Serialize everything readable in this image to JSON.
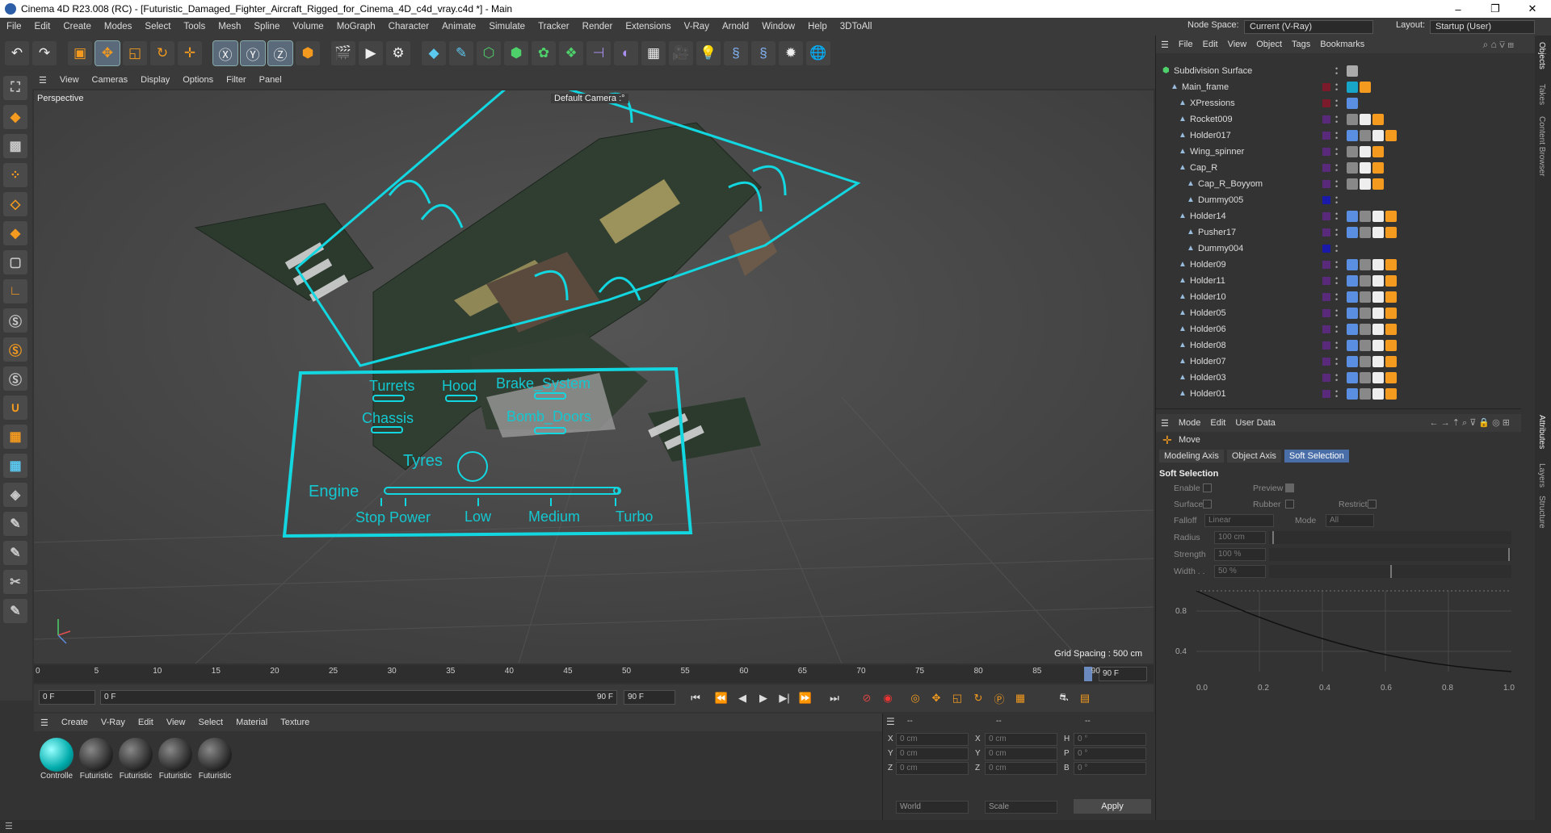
{
  "window": {
    "title": "Cinema 4D R23.008 (RC) - [Futuristic_Damaged_Fighter_Aircraft_Rigged_for_Cinema_4D_c4d_vray.c4d *] - Main",
    "controls": [
      "–",
      "❐",
      "✕"
    ]
  },
  "menubar": [
    "File",
    "Edit",
    "Create",
    "Modes",
    "Select",
    "Tools",
    "Mesh",
    "Spline",
    "Volume",
    "MoGraph",
    "Character",
    "Animate",
    "Simulate",
    "Tracker",
    "Render",
    "Extensions",
    "V-Ray",
    "Arnold",
    "Window",
    "Help",
    "3DToAll"
  ],
  "node_space": {
    "label": "Node Space:",
    "value": "Current (V-Ray)"
  },
  "layout": {
    "label": "Layout:",
    "value": "Startup (User)"
  },
  "viewport": {
    "menu": [
      "View",
      "Cameras",
      "Display",
      "Options",
      "Filter",
      "Panel"
    ],
    "name": "Perspective",
    "camera": "Default Camera :°",
    "grid_spacing": "Grid Spacing : 500 cm",
    "hud": {
      "turrets": "Turrets",
      "hood": "Hood",
      "brake": "Brake_System",
      "chassis": "Chassis",
      "bomb": "Bomb_Doors",
      "tyres": "Tyres",
      "engine": "Engine",
      "stop": "Stop",
      "power": "Power",
      "low": "Low",
      "medium": "Medium",
      "turbo": "Turbo"
    }
  },
  "timeline": {
    "ticks": [
      "0",
      "5",
      "10",
      "15",
      "20",
      "25",
      "30",
      "35",
      "40",
      "45",
      "50",
      "55",
      "60",
      "65",
      "70",
      "75",
      "80",
      "85",
      "90"
    ],
    "end_field": "90 F",
    "current": "0 F",
    "range_start": "0 F",
    "range_end": "90 F",
    "range_end2": "90 F"
  },
  "material_menu": [
    "Create",
    "V-Ray",
    "Edit",
    "View",
    "Select",
    "Material",
    "Texture"
  ],
  "materials": [
    {
      "name": "Controlle",
      "type": "cyan"
    },
    {
      "name": "Futuristic",
      "type": "dark"
    },
    {
      "name": "Futuristic",
      "type": "dark"
    },
    {
      "name": "Futuristic",
      "type": "dark"
    },
    {
      "name": "Futuristic",
      "type": "dark"
    }
  ],
  "coordinates": {
    "header": [
      "--",
      "--",
      "--"
    ],
    "rows": [
      {
        "a": "X",
        "av": "0 cm",
        "b": "X",
        "bv": "0 cm",
        "c": "H",
        "cv": "0 °"
      },
      {
        "a": "Y",
        "av": "0 cm",
        "b": "Y",
        "bv": "0 cm",
        "c": "P",
        "cv": "0 °"
      },
      {
        "a": "Z",
        "av": "0 cm",
        "b": "Z",
        "bv": "0 cm",
        "c": "B",
        "cv": "0 °"
      }
    ],
    "space": "World",
    "mode": "Scale",
    "apply": "Apply"
  },
  "objects_menu": [
    "File",
    "Edit",
    "View",
    "Object",
    "Tags",
    "Bookmarks"
  ],
  "objects": [
    {
      "name": "Subdivision Surface",
      "indent": 0,
      "color": "",
      "tags": "subd"
    },
    {
      "name": "Main_frame",
      "indent": 1,
      "color": "#7a1a2a",
      "tags": "main"
    },
    {
      "name": "XPressions",
      "indent": 2,
      "color": "#7a1a2a",
      "tags": "xp"
    },
    {
      "name": "Rocket009",
      "indent": 2,
      "color": "#5a2a7a",
      "tags": "std"
    },
    {
      "name": "Holder017",
      "indent": 2,
      "color": "#5a2a7a",
      "tags": "full"
    },
    {
      "name": "Wing_spinner",
      "indent": 2,
      "color": "#5a2a7a",
      "tags": "std2"
    },
    {
      "name": "Cap_R",
      "indent": 2,
      "color": "#5a2a7a",
      "tags": "std2"
    },
    {
      "name": "Cap_R_Boyyom",
      "indent": 3,
      "color": "#5a2a7a",
      "tags": "std2"
    },
    {
      "name": "Dummy005",
      "indent": 3,
      "color": "#1a1aaa",
      "tags": ""
    },
    {
      "name": "Holder14",
      "indent": 2,
      "color": "#5a2a7a",
      "tags": "full"
    },
    {
      "name": "Pusher17",
      "indent": 3,
      "color": "#5a2a7a",
      "tags": "full"
    },
    {
      "name": "Dummy004",
      "indent": 3,
      "color": "#1a1aaa",
      "tags": ""
    },
    {
      "name": "Holder09",
      "indent": 2,
      "color": "#5a2a7a",
      "tags": "full"
    },
    {
      "name": "Holder11",
      "indent": 2,
      "color": "#5a2a7a",
      "tags": "full"
    },
    {
      "name": "Holder10",
      "indent": 2,
      "color": "#5a2a7a",
      "tags": "full"
    },
    {
      "name": "Holder05",
      "indent": 2,
      "color": "#5a2a7a",
      "tags": "full"
    },
    {
      "name": "Holder06",
      "indent": 2,
      "color": "#5a2a7a",
      "tags": "full"
    },
    {
      "name": "Holder08",
      "indent": 2,
      "color": "#5a2a7a",
      "tags": "full"
    },
    {
      "name": "Holder07",
      "indent": 2,
      "color": "#5a2a7a",
      "tags": "full"
    },
    {
      "name": "Holder03",
      "indent": 2,
      "color": "#5a2a7a",
      "tags": "full"
    },
    {
      "name": "Holder01",
      "indent": 2,
      "color": "#5a2a7a",
      "tags": "full"
    }
  ],
  "attributes": {
    "menu": [
      "Mode",
      "Edit",
      "User Data"
    ],
    "tool": "Move",
    "tabs": [
      "Modeling Axis",
      "Object Axis",
      "Soft Selection"
    ],
    "section": "Soft Selection",
    "enable": "Enable",
    "preview": "Preview",
    "surface": "Surface",
    "rubber": "Rubber",
    "restrict": "Restrict",
    "falloff": "Falloff",
    "falloff_value": "Linear",
    "mode": "Mode",
    "mode_value": "All",
    "radius": "Radius",
    "radius_value": "100 cm",
    "strength": "Strength",
    "strength_value": "100 %",
    "width": "Width . .",
    "width_value": "50 %",
    "graph_y": [
      "0.8",
      "0.4"
    ],
    "graph_x": [
      "0.0",
      "0.2",
      "0.4",
      "0.6",
      "0.8",
      "1.0"
    ]
  },
  "side_tabs_top": [
    "Objects",
    "Takes",
    "Content Browser"
  ],
  "side_tabs_bottom": [
    "Attributes",
    "Layers",
    "Structure"
  ]
}
